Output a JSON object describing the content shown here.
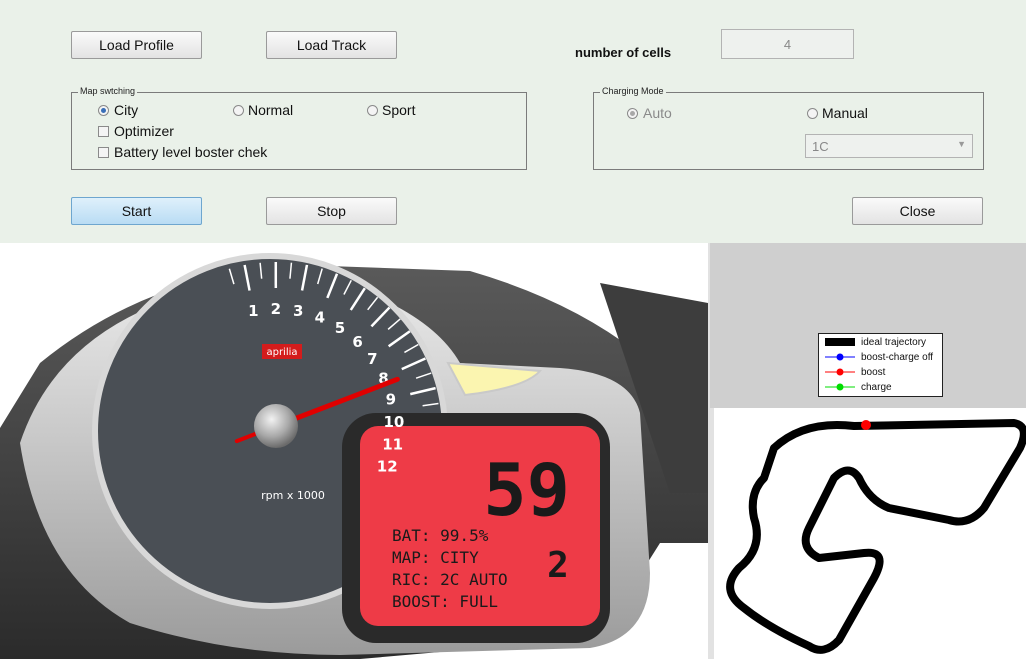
{
  "toolbar": {
    "load_profile": "Load Profile",
    "load_track": "Load Track",
    "cells_label": "number of cells",
    "cells_value": "4",
    "start": "Start",
    "stop": "Stop",
    "close": "Close"
  },
  "map_switching": {
    "title": "Map swtching",
    "options": [
      "City",
      "Normal",
      "Sport"
    ],
    "selected": "City",
    "optimizer_label": "Optimizer",
    "battery_label": "Battery level boster chek"
  },
  "charging_mode": {
    "title": "Charging Mode",
    "options": [
      "Auto",
      "Manual"
    ],
    "selected": "Auto",
    "rate_value": "1C"
  },
  "dashboard": {
    "rpm_ticks": [
      "1",
      "2",
      "3",
      "4",
      "5",
      "6",
      "7",
      "8",
      "9",
      "10",
      "11",
      "12"
    ],
    "rpm_unit": "rpm x 1000",
    "brand": "aprilia",
    "rpm_value": 8.3,
    "speed": "59",
    "gear": "2",
    "battery": "BAT: 99.5%",
    "map": "MAP: CITY",
    "ric": "RIC: 2C AUTO",
    "boost": "BOOST: FULL"
  },
  "legend": {
    "items": [
      {
        "label": "ideal trajectory",
        "color": "#000000"
      },
      {
        "label": "boost-charge off",
        "color": "#0000ff"
      },
      {
        "label": "boost",
        "color": "#ff0000"
      },
      {
        "label": "charge",
        "color": "#00dd00"
      }
    ]
  },
  "colors": {
    "panel_bg": "#eaf1e9",
    "lcd_red": "#ee3b47",
    "needle_red": "#e00000",
    "dial_face": "#4a4f55"
  }
}
